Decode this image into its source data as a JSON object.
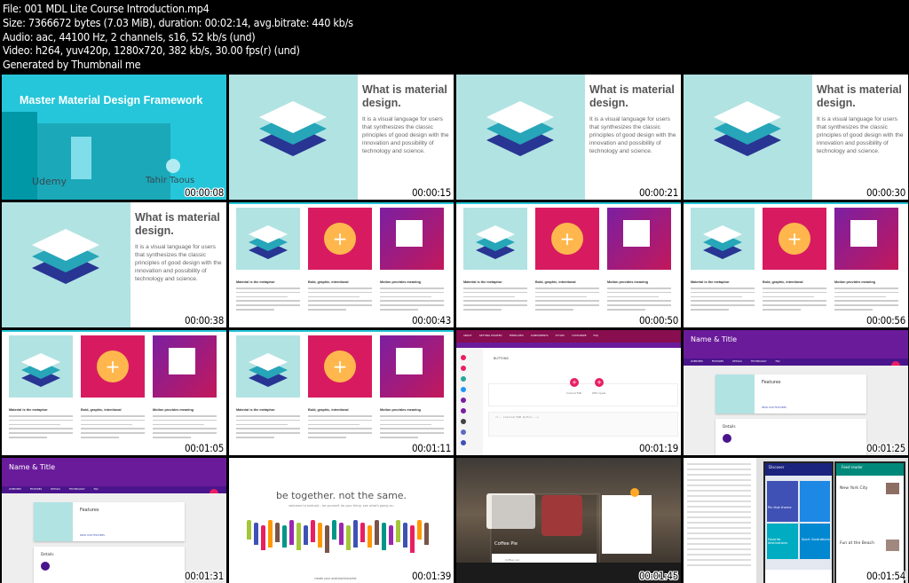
{
  "header": {
    "lines": [
      "File: 001 MDL Lite Course Introduction.mp4",
      "Size: 7366672 bytes (7.03 MiB), duration: 00:02:14, avg.bitrate: 440 kb/s",
      "Audio: aac, 44100 Hz, 2 channels, s16, 52 kb/s (und)",
      "Video: h264, yuv420p, 1280x720, 382 kb/s, 30.00 fps(r) (und)",
      "Generated by Thumbnail me"
    ]
  },
  "frames": [
    {
      "time": "00:00:08",
      "kind": "title",
      "title": "Master Material Design Framework",
      "platform": "Udemy",
      "author": "Tahir Taous"
    },
    {
      "time": "00:00:15",
      "kind": "what"
    },
    {
      "time": "00:00:21",
      "kind": "what"
    },
    {
      "time": "00:00:30",
      "kind": "what"
    },
    {
      "time": "00:00:38",
      "kind": "what"
    },
    {
      "time": "00:00:43",
      "kind": "overview"
    },
    {
      "time": "00:00:50",
      "kind": "overview"
    },
    {
      "time": "00:00:56",
      "kind": "overview"
    },
    {
      "time": "00:01:05",
      "kind": "overview"
    },
    {
      "time": "00:01:11",
      "kind": "overview"
    },
    {
      "time": "00:01:19",
      "kind": "components"
    },
    {
      "time": "00:01:25",
      "kind": "nametitle"
    },
    {
      "time": "00:01:31",
      "kind": "nametitle"
    },
    {
      "time": "00:01:39",
      "kind": "android"
    },
    {
      "time": "00:01:45",
      "kind": "coffee"
    },
    {
      "time": "00:01:54",
      "kind": "phones"
    }
  ],
  "what": {
    "title": "What is material design.",
    "body": "It is a visual language for users that synthesizes the classic principles of good design with the innovation and possibility of technology and science."
  },
  "overview": {
    "headings": [
      "Material is the metaphor",
      "Bold, graphic, intentional",
      "Motion provides meaning"
    ]
  },
  "components": {
    "nav": [
      "ABOUT",
      "GETTING STARTED",
      "TEMPLATES",
      "COMPONENTS",
      "STYLES",
      "CUSTOMIZE",
      "FAQ"
    ],
    "section": "BUTTONS",
    "code_label": "<!-- Colored FAB button -->",
    "fab_labels": [
      "Colored FAB",
      "With ripple"
    ]
  },
  "nametitle": {
    "title": "Name & Title",
    "tabs": [
      "OVERVIEW",
      "FEATURES",
      "DETAILS",
      "TECHNOLOGY",
      "FAQ"
    ],
    "features": "Features",
    "details": "Details",
    "read_more": "READ OUR FEATURES"
  },
  "android": {
    "headline": "be together. not the same.",
    "sub": "welcome to android... be yourself. do your thing. see what's going on.",
    "footer": "create your android/character"
  },
  "coffee": {
    "card_title": "Coffee Pie",
    "card_sub": "Coffee cup"
  },
  "phones": {
    "app1": "Discover",
    "app2": "Feed reader",
    "city": "New York City",
    "article": "Fun at the Beach",
    "card1": "Pin that theme",
    "card2": "Favorite destinations",
    "card3": "Sport illustrations"
  },
  "colors": {
    "teal": "#26c6da",
    "pink": "#e91e63",
    "purple": "#6a1b9a",
    "indigo": "#3949ab",
    "amber": "#ffb74d"
  }
}
